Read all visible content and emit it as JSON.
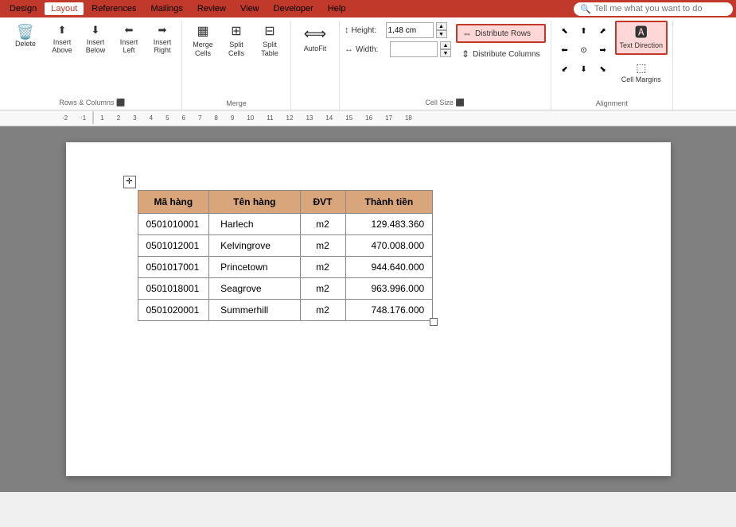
{
  "menu": {
    "items": [
      "Design",
      "Layout",
      "References",
      "Mailings",
      "Review",
      "View",
      "Developer",
      "Help"
    ],
    "active": "Layout",
    "search_placeholder": "Tell me what you want to do"
  },
  "ribbon": {
    "groups": {
      "rows_columns": {
        "label": "Rows & Columns",
        "delete_label": "Delete",
        "insert_above_label": "Insert\nAbove",
        "insert_below_label": "Insert\nBelow",
        "insert_left_label": "Insert\nLeft",
        "insert_right_label": "Insert\nRight"
      },
      "merge": {
        "label": "Merge",
        "merge_cells_label": "Merge\nCells",
        "split_cells_label": "Split\nCells",
        "split_table_label": "Split\nTable"
      },
      "autofit": {
        "label": "",
        "autofit_label": "AutoFit"
      },
      "cell_size": {
        "label": "Cell Size",
        "height_label": "Height:",
        "height_value": "1,48 cm",
        "width_label": "Width:",
        "width_value": "",
        "distribute_rows_label": "Distribute Rows",
        "distribute_cols_label": "Distribute Columns"
      },
      "alignment": {
        "label": "Alignment",
        "text_direction_label": "Text\nDirection",
        "cell_margins_label": "Cell\nMargins"
      }
    }
  },
  "table": {
    "headers": [
      "Mã hàng",
      "Tên hàng",
      "ĐVT",
      "Thành tiền"
    ],
    "rows": [
      [
        "0501010001",
        "Harlech",
        "m2",
        "129.483.360"
      ],
      [
        "0501012001",
        "Kelvingrove",
        "m2",
        "470.008.000"
      ],
      [
        "0501017001",
        "Princetown",
        "m2",
        "944.640.000"
      ],
      [
        "0501018001",
        "Seagrove",
        "m2",
        "963.996.000"
      ],
      [
        "0501020001",
        "Summerhill",
        "m2",
        "748.176.000"
      ]
    ]
  },
  "ruler": {
    "markers": [
      "2",
      "1",
      "1",
      "2",
      "3",
      "4",
      "5",
      "6",
      "7",
      "8",
      "9",
      "10",
      "11",
      "12",
      "13",
      "14",
      "15",
      "16",
      "17",
      "18"
    ]
  }
}
